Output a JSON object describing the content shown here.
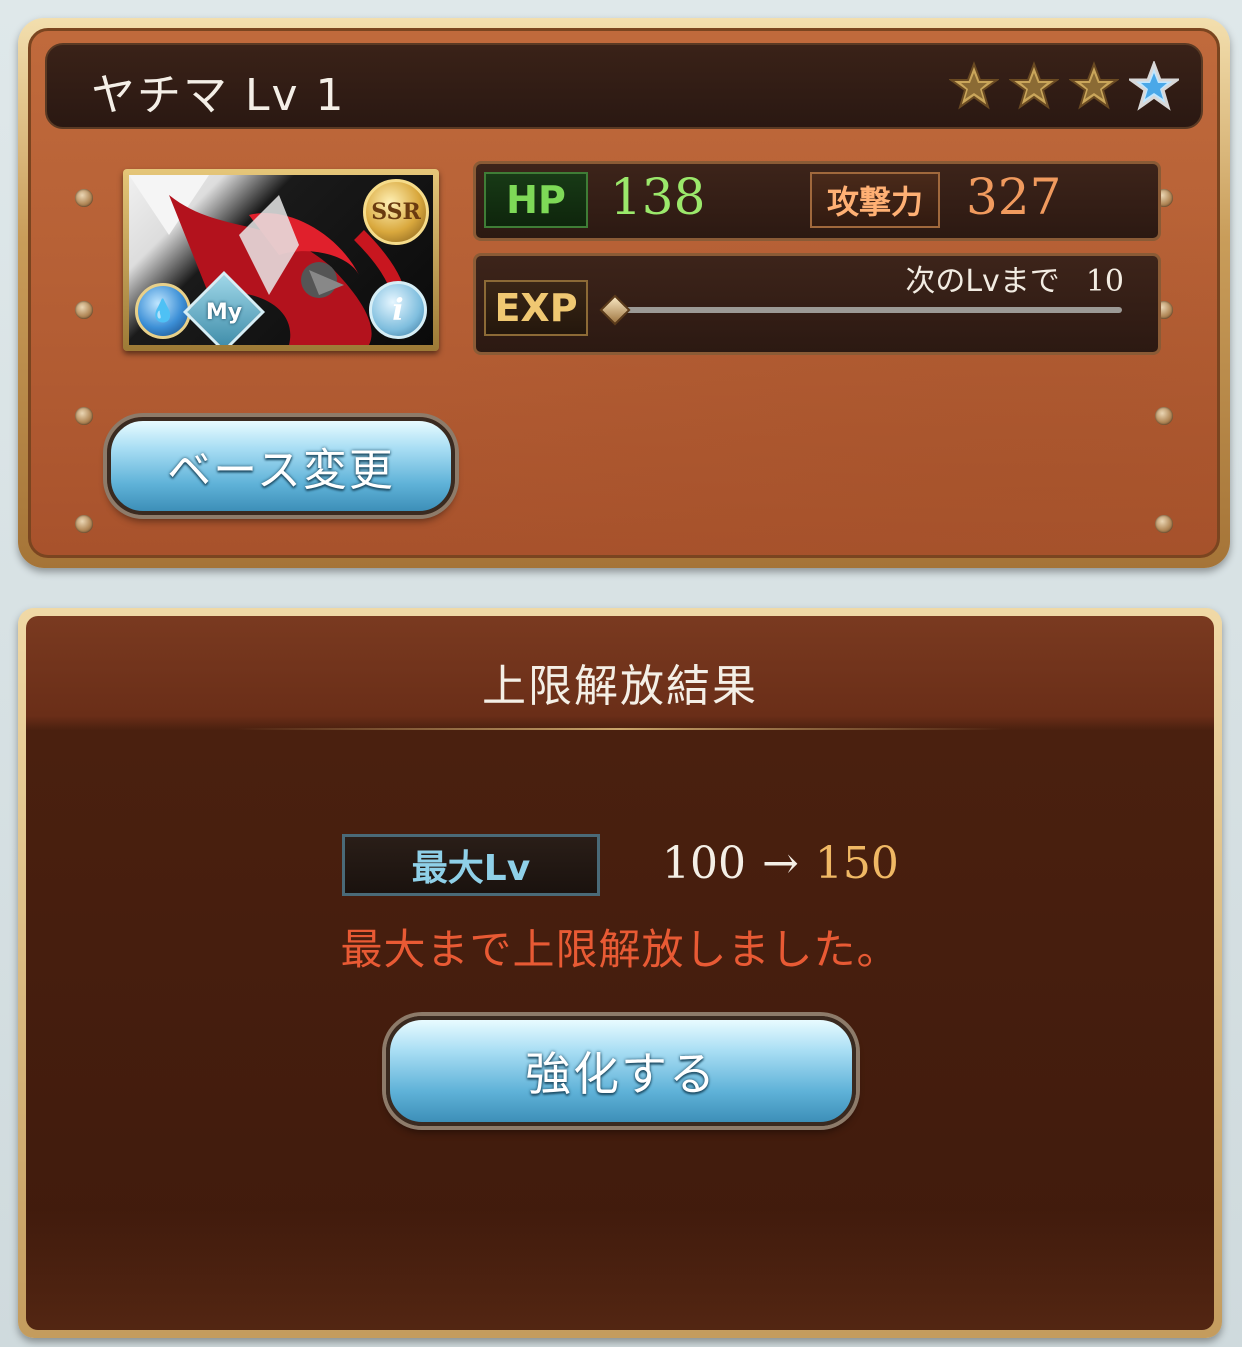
{
  "header": {
    "unit_name": "ヤチマ Lv 1",
    "stars": [
      {
        "icon": "star-gold-icon",
        "filled": true
      },
      {
        "icon": "star-gold-icon",
        "filled": true
      },
      {
        "icon": "star-gold-icon",
        "filled": true
      },
      {
        "icon": "star-blue-icon",
        "filled": true
      }
    ]
  },
  "portrait": {
    "rarity": "SSR",
    "element_icon": "water-element-icon",
    "my_badge": "My",
    "info_icon": "i"
  },
  "stats": {
    "hp_label": "HP",
    "hp_value": "138",
    "atk_label": "攻撃力",
    "atk_value": "327"
  },
  "exp": {
    "label": "EXP",
    "next_lv_text": "次のLvまで",
    "next_lv_value": "10",
    "progress": 0.0
  },
  "buttons": {
    "base_change": "ベース変更",
    "enhance": "強化する"
  },
  "result": {
    "title": "上限解放結果",
    "max_lv_label": "最大Lv",
    "old_lv": "100",
    "arrow": "→",
    "new_lv": "150",
    "message": "最大まで上限解放しました。"
  },
  "colors": {
    "hp_value": "#9be86b",
    "atk_value": "#f09a5e",
    "new_lv": "#f0b864",
    "message": "#e85a34"
  }
}
